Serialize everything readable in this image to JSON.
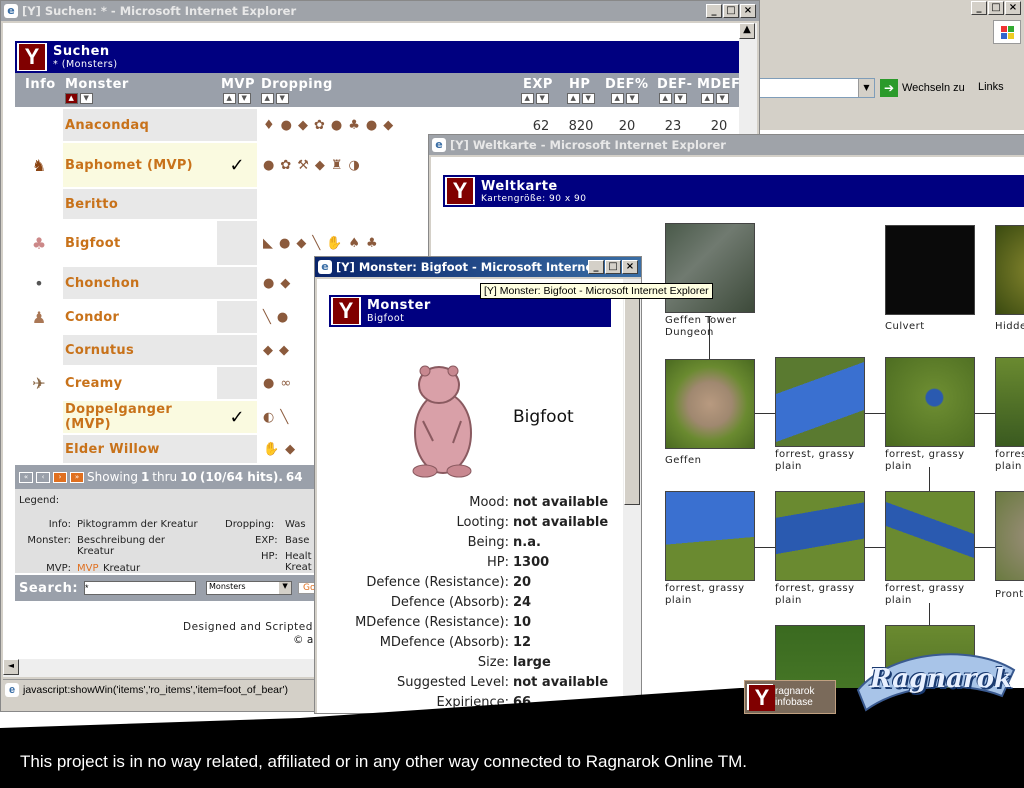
{
  "desktop_window": {
    "title_bar_buttons": [
      "_",
      "□",
      "×"
    ],
    "go_label": "Wechseln zu",
    "links_label": "Links"
  },
  "search_window": {
    "title": "[Y] Suchen: * - Microsoft Internet Explorer",
    "banner_title": "Suchen",
    "banner_sub": "* (Monsters)",
    "columns": {
      "info": "Info",
      "monster": "Monster",
      "mvp": "MVP",
      "dropping": "Dropping",
      "exp": "EXP",
      "hp": "HP",
      "defp": "DEF%",
      "defm": "DEF-",
      "mdef": "MDEF%"
    },
    "rows": [
      {
        "name": "Anacondaq",
        "mvp": "",
        "exp": "62",
        "hp": "820",
        "defp": "20",
        "defm": "23",
        "mdef": "20"
      },
      {
        "name": "Baphomet (MVP)",
        "mvp": "✓"
      },
      {
        "name": "Beritto",
        "mvp": ""
      },
      {
        "name": "Bigfoot",
        "mvp": ""
      },
      {
        "name": "Chonchon",
        "mvp": ""
      },
      {
        "name": "Condor",
        "mvp": ""
      },
      {
        "name": "Cornutus",
        "mvp": ""
      },
      {
        "name": "Creamy",
        "mvp": ""
      },
      {
        "name": "Doppelganger (MVP)",
        "mvp": "✓"
      },
      {
        "name": "Elder Willow",
        "mvp": ""
      }
    ],
    "pager": {
      "showing": "Showing",
      "from": "1",
      "thru": "thru",
      "to": "10",
      "hits": "(10/64 hits).",
      "extra": "64"
    },
    "legend_label": "Legend:",
    "legend": {
      "info_k": "Info:",
      "info_v": "Piktogramm der Kreatur",
      "monster_k": "Monster:",
      "monster_v": "Beschreibung der Kreatur",
      "mvp_k": "MVP:",
      "mvp_v_prefix": "MVP",
      "mvp_v": "Kreatur",
      "dropping_k": "Dropping:",
      "dropping_v": "Was",
      "exp_k": "EXP:",
      "exp_v": "Base",
      "hp_k": "HP:",
      "hp_v": "Healt Kreat"
    },
    "search_label": "Search:",
    "search_value": "*",
    "select_value": "Monsters",
    "go": "Go",
    "footer1": "Designed and Scripted",
    "footer2": "© a",
    "status": "javascript:showWin('items','ro_items','item=foot_of_bear')"
  },
  "map_window": {
    "title": "[Y] Weltkarte - Microsoft Internet Explorer",
    "banner_title": "Weltkarte",
    "banner_sub": "Kartengröße: 90 x 90",
    "captions": {
      "c1": "Geffen Tower Dungeon",
      "c2": "Culvert",
      "c3": "Hidde",
      "c4": "Geffen",
      "c5": "forrest, grassy plain",
      "c6": "forrest, grassy plain",
      "c7": "forres plain",
      "c8": "forrest, grassy plain",
      "c9": "forrest, grassy plain",
      "c10": "forrest, grassy plain",
      "c11": "Pront"
    }
  },
  "monster_window": {
    "title": "[Y] Monster: Bigfoot - Microsoft Internet E...",
    "tooltip": "[Y] Monster: Bigfoot - Microsoft Internet Explorer",
    "banner_title": "Monster",
    "banner_sub": "Bigfoot",
    "name": "Bigfoot",
    "stats": [
      {
        "k": "Mood:",
        "v": "not available"
      },
      {
        "k": "Looting:",
        "v": "not available"
      },
      {
        "k": "Being:",
        "v": "n.a."
      },
      {
        "k": "HP:",
        "v": "1300"
      },
      {
        "k": "Defence (Resistance):",
        "v": "20"
      },
      {
        "k": "Defence (Absorb):",
        "v": "24"
      },
      {
        "k": "MDefence (Resistance):",
        "v": "10"
      },
      {
        "k": "MDefence (Absorb):",
        "v": "12"
      },
      {
        "k": "Size:",
        "v": "large"
      },
      {
        "k": "Suggested Level:",
        "v": "not available"
      },
      {
        "k": "Expirience:",
        "v": "66"
      }
    ]
  },
  "branding": {
    "ro_logo": "Ragnarok",
    "infobase_1": "ragnarok",
    "infobase_2": "infobase"
  },
  "disclaimer": "This project is in no way related, affiliated or in any other way connected to Ragnarok Online TM."
}
